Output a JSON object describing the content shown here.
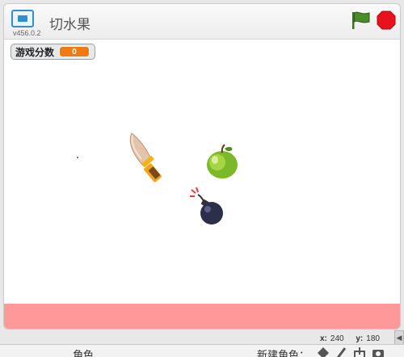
{
  "title_bar": {
    "project_title": "切水果",
    "version": "v456.0.2",
    "fullscreen_icon": "fullscreen-icon",
    "green_flag_icon": "green-flag-icon",
    "stop_icon": "stop-icon",
    "flag_color": "#4a8c2a",
    "stop_color": "#e8121d"
  },
  "stage": {
    "variable_monitor": {
      "label": "游戏分数",
      "value": "0"
    },
    "sprites": [
      "knife-icon",
      "apple-icon",
      "bomb-icon"
    ],
    "ground_color": "#ff9999"
  },
  "coordinates": {
    "x_label": "x:",
    "x_value": "240",
    "y_label": "y:",
    "y_value": "180"
  },
  "bottom_panel": {
    "sprites_tab": "角色",
    "new_sprite_label": "新建角色：",
    "icons": [
      "paint-sprite-icon",
      "brush-icon",
      "upload-icon",
      "camera-icon"
    ]
  }
}
